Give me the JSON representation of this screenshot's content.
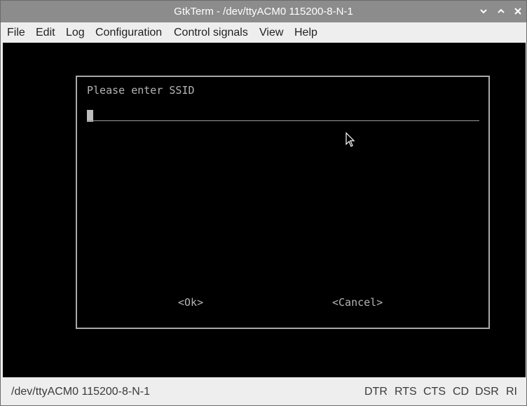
{
  "window": {
    "title": "GtkTerm - /dev/ttyACM0  115200-8-N-1"
  },
  "window_controls": {
    "minimize_icon": "chevron-down-icon",
    "maximize_icon": "chevron-up-icon",
    "close_icon": "close-icon"
  },
  "menu": {
    "items": [
      "File",
      "Edit",
      "Log",
      "Configuration",
      "Control signals",
      "View",
      "Help"
    ]
  },
  "dialog": {
    "prompt": "Please enter SSID",
    "input_value": "",
    "ok_label": "<Ok>",
    "cancel_label": "<Cancel>"
  },
  "statusbar": {
    "port_info": "/dev/ttyACM0  115200-8-N-1",
    "signals": [
      "DTR",
      "RTS",
      "CTS",
      "CD",
      "DSR",
      "RI"
    ]
  },
  "colors": {
    "titlebar_bg": "#8c8c8c",
    "menubar_bg": "#eeeeee",
    "terminal_bg": "#000000",
    "terminal_text": "#b5b5b5",
    "dialog_border": "#a9a9a9"
  }
}
